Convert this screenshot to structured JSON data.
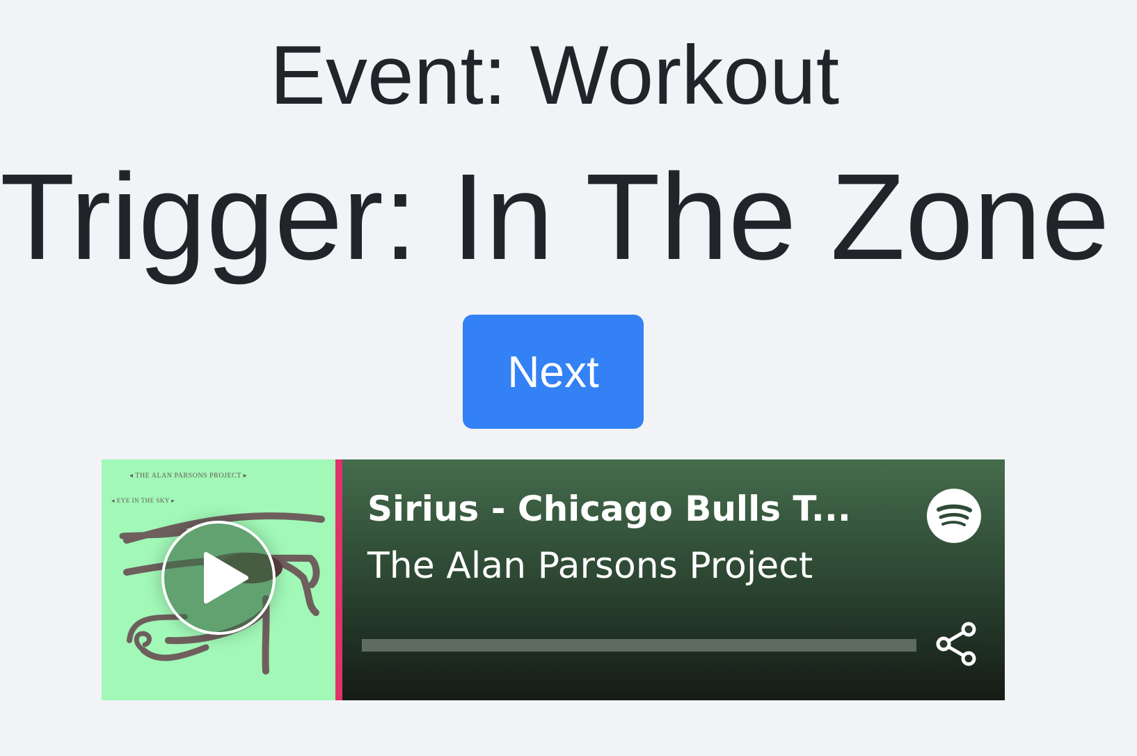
{
  "page": {
    "event_title": "Event: Workout",
    "trigger_title": "Trigger: In The Zone",
    "next_label": "Next"
  },
  "player": {
    "track_title": "Sirius - Chicago Bulls T...",
    "artist": "The Alan Parsons Project",
    "album_art_band_text": "THE ALAN PARSONS PROJECT",
    "album_art_album_text": "EYE IN THE SKY",
    "progress_fraction": 0,
    "colors": {
      "accent_bar": "#e0326b",
      "album_art_bg": "#a1f8b7",
      "next_button": "#3381f4"
    },
    "icons": {
      "play": "play-icon",
      "logo": "spotify-icon",
      "share": "share-icon"
    }
  }
}
